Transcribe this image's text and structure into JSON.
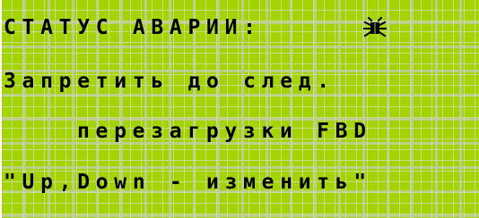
{
  "screen": {
    "line1": "СТАТУС АВАРИИ:",
    "line2": "Запретить до след.",
    "line3": "перезагрузки FBD",
    "line4": "\"Up,Down - изменить\""
  },
  "icons": {
    "status_icon": "bug-icon"
  },
  "colors": {
    "lcd_background": "#a4d400",
    "text": "#000000",
    "grid": "#cddca0"
  }
}
